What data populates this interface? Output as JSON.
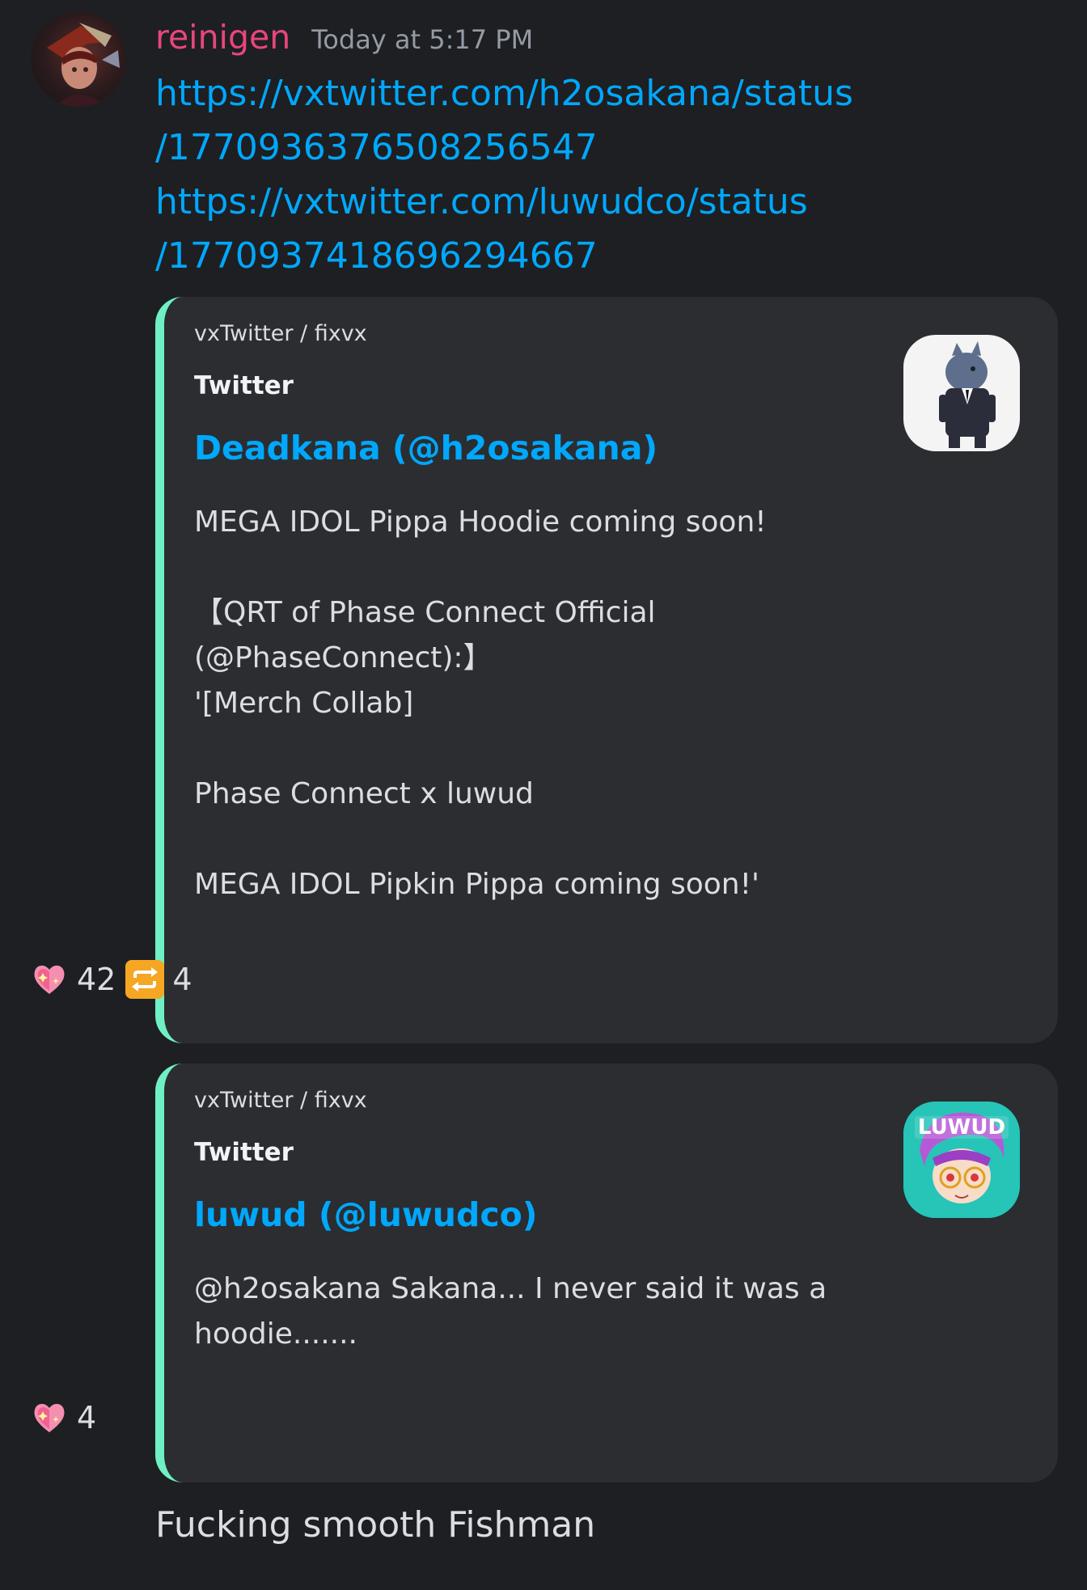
{
  "message": {
    "username": "reinigen",
    "timestamp": "Today at 5:17 PM",
    "links": [
      "https://vxtwitter.com/h2osakana/status",
      "/1770936376508256547",
      "https://vxtwitter.com/luwudco/status",
      "/1770937418696294667"
    ],
    "reply_text": "Fucking smooth Fishman"
  },
  "embeds": [
    {
      "provider": "vxTwitter / fixvx",
      "site": "Twitter",
      "author": "Deadkana (@h2osakana)",
      "lines": [
        "MEGA IDOL Pippa Hoodie coming soon!",
        "",
        "【QRT of Phase Connect Official",
        "(@PhaseConnect):】",
        "'[Merch Collab]",
        "",
        "Phase Connect x luwud",
        "",
        "MEGA IDOL Pipkin Pippa coming soon!'"
      ],
      "likes": "42",
      "retweets": "4"
    },
    {
      "provider": "vxTwitter / fixvx",
      "site": "Twitter",
      "author": "luwud (@luwudco)",
      "text_line1": "@h2osakana Sakana... I never said it was a",
      "text_line2": "hoodie.......",
      "likes": "4",
      "thumb_label": "LUWUD"
    }
  ],
  "colors": {
    "background": "#1e1f22",
    "embed_bg": "#2b2d31",
    "embed_border": "#6ff0c3",
    "link": "#00a8fc",
    "username": "#e8467c"
  }
}
